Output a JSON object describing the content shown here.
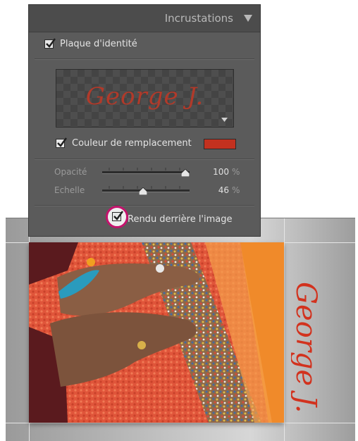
{
  "panel": {
    "title": "Incrustations",
    "identity_plate": {
      "label": "Plaque d'identité",
      "checked": true,
      "signature_text": "George J."
    },
    "override_color": {
      "label": "Couleur de remplacement",
      "checked": true,
      "color": "#c3311f"
    },
    "opacity": {
      "label": "Opacité",
      "value": "100",
      "unit": "%",
      "fraction": 1.0
    },
    "scale": {
      "label": "Echelle",
      "value": "46",
      "unit": "%",
      "fraction": 0.46
    },
    "render_behind": {
      "label": "Rendu derrière l'image",
      "checked": true
    }
  },
  "canvas": {
    "watermark_text": "George J.",
    "watermark_color": "#d2321e"
  },
  "colors": {
    "panel_bg": "#5b5b5b",
    "highlight": "#c4136d"
  }
}
